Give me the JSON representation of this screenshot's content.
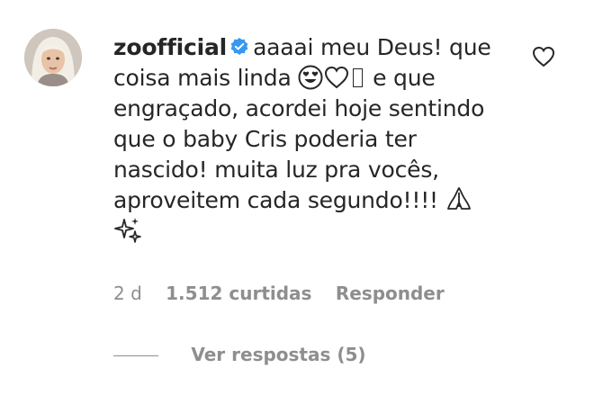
{
  "comment": {
    "username": "zoofficial",
    "text_part1": "aaaai meu Deus! que coisa mais linda",
    "text_part2": "e que engraçado, acordei hoje sentindo que o baby Cris poderia ter nascido! muita luz pra vocês, aproveitem cada segundo!!!!",
    "emojis": [
      "heart-eyes-emoji",
      "white-heart-emoji",
      "missing-glyph",
      "folded-hands-emoji",
      "sparkles-emoji"
    ]
  },
  "meta": {
    "time": "2 d",
    "likes": "1.512 curtidas",
    "reply_label": "Responder"
  },
  "replies": {
    "label": "Ver respostas (5)"
  },
  "colors": {
    "text": "#262626",
    "secondary": "#8e8e8e",
    "verified": "#3897f0"
  }
}
